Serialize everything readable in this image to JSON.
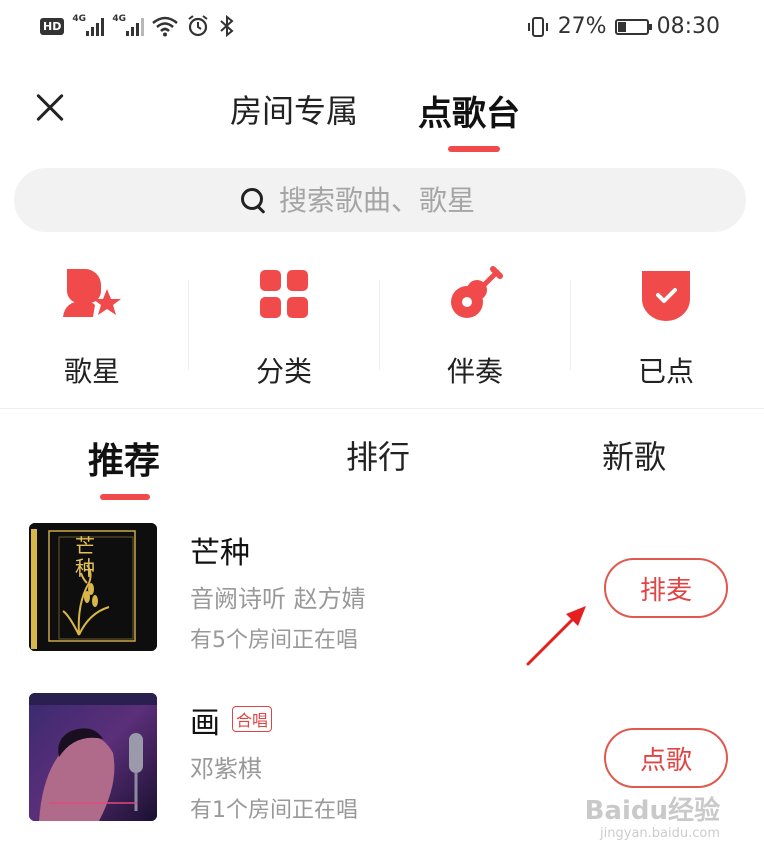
{
  "status_bar": {
    "hd": "HD",
    "sim1": "4G",
    "sim2": "4G",
    "battery": "27%",
    "time": "08:30"
  },
  "header": {
    "tabs": [
      {
        "label": "房间专属",
        "active": false
      },
      {
        "label": "点歌台",
        "active": true
      }
    ]
  },
  "search": {
    "placeholder": "搜索歌曲、歌星"
  },
  "categories": [
    {
      "label": "歌星",
      "icon": "singer-icon"
    },
    {
      "label": "分类",
      "icon": "category-grid-icon"
    },
    {
      "label": "伴奏",
      "icon": "guitar-icon"
    },
    {
      "label": "已点",
      "icon": "checked-shield-icon"
    }
  ],
  "sub_tabs": [
    {
      "label": "推荐",
      "active": true
    },
    {
      "label": "排行",
      "active": false
    },
    {
      "label": "新歌",
      "active": false
    }
  ],
  "songs": [
    {
      "title": "芒种",
      "artist": "音阙诗听 赵方婧",
      "rooms": "有5个房间正在唱",
      "action": "排麦",
      "badge": null,
      "cover_text": "芒种"
    },
    {
      "title": "画",
      "artist": "邓紫棋",
      "rooms": "有1个房间正在唱",
      "action": "点歌",
      "badge": "合唱"
    }
  ],
  "colors": {
    "accent": "#f04a4a",
    "button_border": "#e0584e",
    "muted_text": "#999999"
  },
  "watermark": {
    "brand": "Baidu经验",
    "url": "jingyan.baidu.com"
  }
}
